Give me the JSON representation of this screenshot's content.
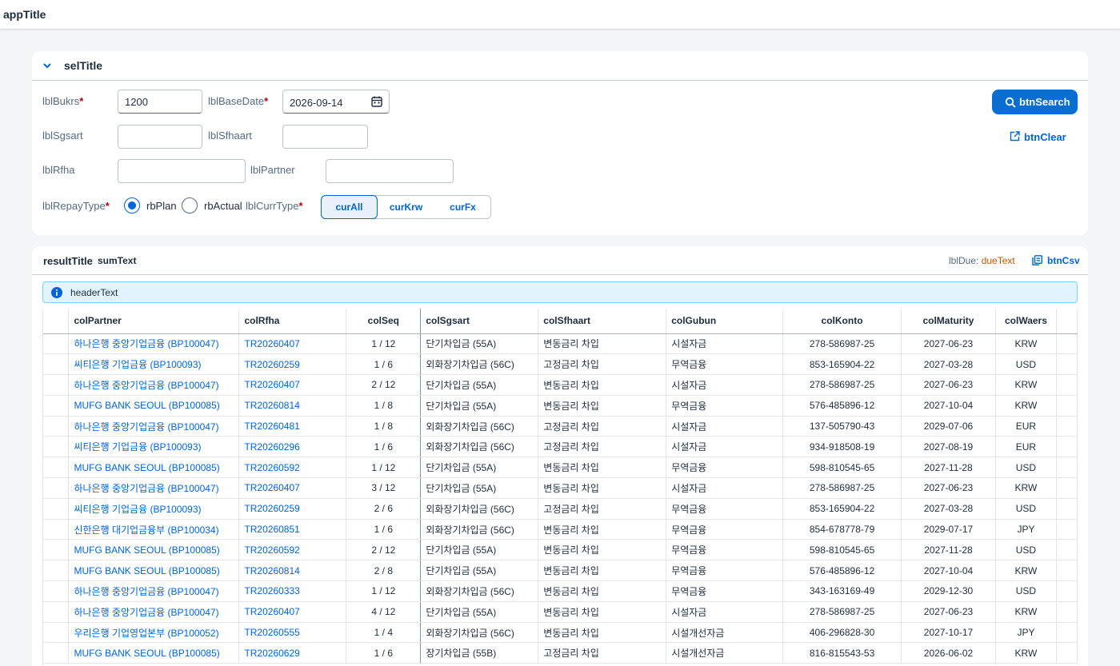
{
  "app": {
    "title": "appTitle"
  },
  "selection": {
    "title": "selTitle",
    "bukrs": {
      "label": "lblBukrs",
      "value": "1200"
    },
    "baseDate": {
      "label": "lblBaseDate",
      "value": "2026-09-14"
    },
    "sgsart": {
      "label": "lblSgsart",
      "value": ""
    },
    "sfhaart": {
      "label": "lblSfhaart",
      "value": ""
    },
    "rfha": {
      "label": "lblRfha",
      "value": ""
    },
    "partner": {
      "label": "lblPartner",
      "value": ""
    },
    "repayType": {
      "label": "lblRepayType",
      "options": [
        "rbPlan",
        "rbActual"
      ],
      "selected": "rbPlan"
    },
    "currType": {
      "label": "lblCurrType",
      "options": [
        "curAll",
        "curKrw",
        "curFx"
      ],
      "selected": "curAll"
    },
    "searchButton": "btnSearch",
    "clearButton": "btnClear",
    "requiredMark": "*"
  },
  "result": {
    "title": "resultTitle",
    "sumText": "sumText",
    "dueLabel": "lblDue:",
    "dueValue": "dueText",
    "csvButton": "btnCsv",
    "headerText": "headerText",
    "columns": [
      "colPartner",
      "colRfha",
      "colSeq",
      "colSgsart",
      "colSfhaart",
      "colGubun",
      "colKonto",
      "colMaturity",
      "colWaers"
    ],
    "rows": [
      [
        "하나은행 중앙기업금융 (BP100047)",
        "TR20260407",
        "1 / 12",
        "단기차입금 (55A)",
        "변동금리 차입",
        "시설자금",
        "278-586987-25",
        "2027-06-23",
        "KRW"
      ],
      [
        "씨티은행 기업금융 (BP100093)",
        "TR20260259",
        "1 / 6",
        "외화장기차입금 (56C)",
        "고정금리 차입",
        "무역금융",
        "853-165904-22",
        "2027-03-28",
        "USD"
      ],
      [
        "하나은행 중앙기업금융 (BP100047)",
        "TR20260407",
        "2 / 12",
        "단기차입금 (55A)",
        "변동금리 차입",
        "시설자금",
        "278-586987-25",
        "2027-06-23",
        "KRW"
      ],
      [
        "MUFG BANK SEOUL (BP100085)",
        "TR20260814",
        "1 / 8",
        "단기차입금 (55A)",
        "변동금리 차입",
        "무역금융",
        "576-485896-12",
        "2027-10-04",
        "KRW"
      ],
      [
        "하나은행 중앙기업금융 (BP100047)",
        "TR20260481",
        "1 / 8",
        "외화장기차입금 (56C)",
        "고정금리 차입",
        "시설자금",
        "137-505790-43",
        "2029-07-06",
        "EUR"
      ],
      [
        "씨티은행 기업금융 (BP100093)",
        "TR20260296",
        "1 / 6",
        "외화장기차입금 (56C)",
        "고정금리 차입",
        "시설자금",
        "934-918508-19",
        "2027-08-19",
        "EUR"
      ],
      [
        "MUFG BANK SEOUL (BP100085)",
        "TR20260592",
        "1 / 12",
        "단기차입금 (55A)",
        "변동금리 차입",
        "무역금융",
        "598-810545-65",
        "2027-11-28",
        "USD"
      ],
      [
        "하나은행 중앙기업금융 (BP100047)",
        "TR20260407",
        "3 / 12",
        "단기차입금 (55A)",
        "변동금리 차입",
        "시설자금",
        "278-586987-25",
        "2027-06-23",
        "KRW"
      ],
      [
        "씨티은행 기업금융 (BP100093)",
        "TR20260259",
        "2 / 6",
        "외화장기차입금 (56C)",
        "고정금리 차입",
        "무역금융",
        "853-165904-22",
        "2027-03-28",
        "USD"
      ],
      [
        "신한은행 대기업금융부 (BP100034)",
        "TR20260851",
        "1 / 6",
        "외화장기차입금 (56C)",
        "변동금리 차입",
        "무역금융",
        "854-678778-79",
        "2029-07-17",
        "JPY"
      ],
      [
        "MUFG BANK SEOUL (BP100085)",
        "TR20260592",
        "2 / 12",
        "단기차입금 (55A)",
        "변동금리 차입",
        "무역금융",
        "598-810545-65",
        "2027-11-28",
        "USD"
      ],
      [
        "MUFG BANK SEOUL (BP100085)",
        "TR20260814",
        "2 / 8",
        "단기차입금 (55A)",
        "변동금리 차입",
        "무역금융",
        "576-485896-12",
        "2027-10-04",
        "KRW"
      ],
      [
        "하나은행 중앙기업금융 (BP100047)",
        "TR20260333",
        "1 / 12",
        "외화장기차입금 (56C)",
        "변동금리 차입",
        "무역금융",
        "343-163169-49",
        "2029-12-30",
        "USD"
      ],
      [
        "하나은행 중앙기업금융 (BP100047)",
        "TR20260407",
        "4 / 12",
        "단기차입금 (55A)",
        "변동금리 차입",
        "시설자금",
        "278-586987-25",
        "2027-06-23",
        "KRW"
      ],
      [
        "우리은행 기업영업본부 (BP100052)",
        "TR20260555",
        "1 / 4",
        "외화장기차입금 (56C)",
        "변동금리 차입",
        "시설개선자금",
        "406-296828-30",
        "2027-10-17",
        "JPY"
      ],
      [
        "MUFG BANK SEOUL (BP100085)",
        "TR20260629",
        "1 / 6",
        "장기차입금 (55B)",
        "고정금리 차입",
        "시설개선자금",
        "816-815543-53",
        "2026-06-02",
        "KRW"
      ]
    ]
  },
  "colors": {
    "accent": "#0a6ed1",
    "link": "#0064d9",
    "due": "#c35500",
    "infoBg": "#e1f4ff"
  },
  "icons": [
    "chevron-down-icon",
    "calendar-icon",
    "search-icon",
    "clear-icon",
    "csv-icon",
    "info-icon"
  ]
}
